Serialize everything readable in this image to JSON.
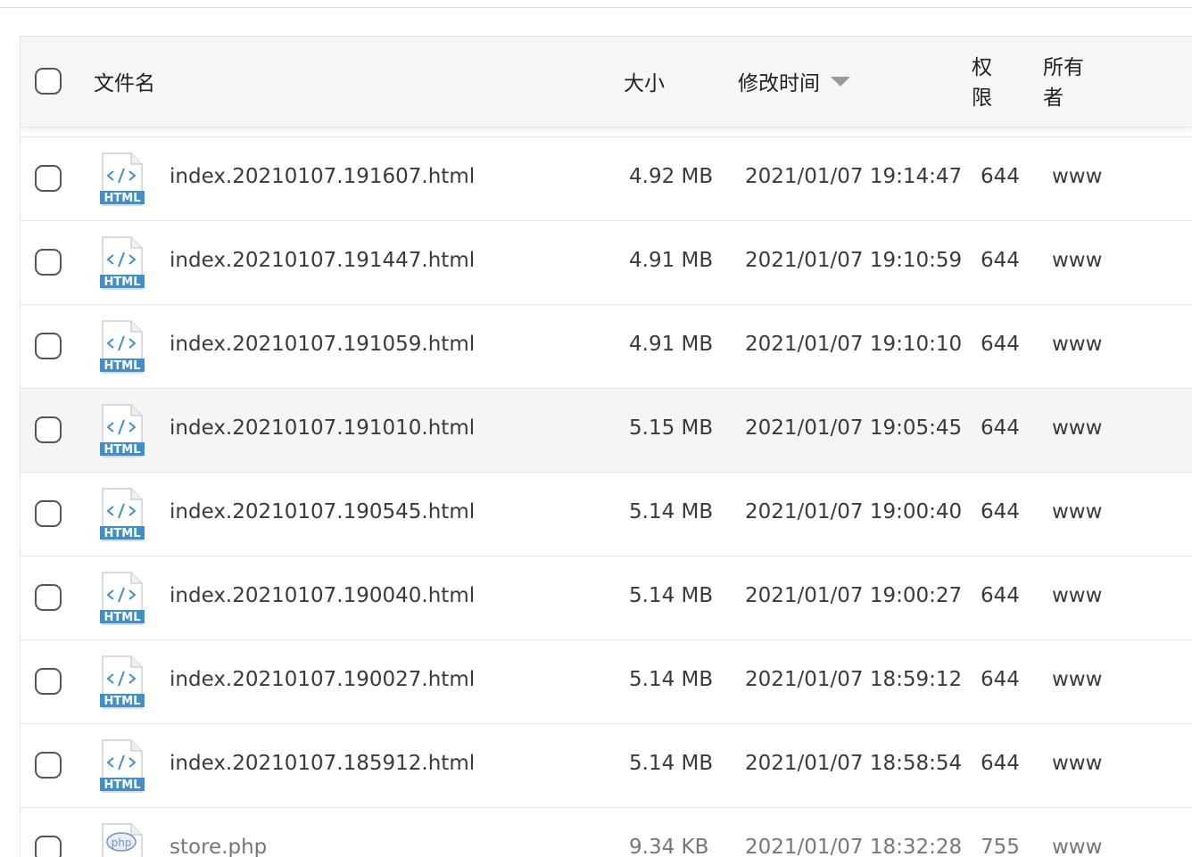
{
  "header": {
    "name": "文件名",
    "size": "大小",
    "mtime": "修改时间",
    "perm_line1": "权",
    "perm_line2": "限",
    "owner_line1": "所有",
    "owner_line2": "者",
    "sort_icon": "sort-desc-icon"
  },
  "files": [
    {
      "name": "index.20210107.191607.html",
      "size": "4.92 MB",
      "mtime": "2021/01/07 19:14:47",
      "perm": "644",
      "owner": "www",
      "icon": "html-file-icon"
    },
    {
      "name": "index.20210107.191447.html",
      "size": "4.91 MB",
      "mtime": "2021/01/07 19:10:59",
      "perm": "644",
      "owner": "www",
      "icon": "html-file-icon"
    },
    {
      "name": "index.20210107.191059.html",
      "size": "4.91 MB",
      "mtime": "2021/01/07 19:10:10",
      "perm": "644",
      "owner": "www",
      "icon": "html-file-icon"
    },
    {
      "name": "index.20210107.191010.html",
      "size": "5.15 MB",
      "mtime": "2021/01/07 19:05:45",
      "perm": "644",
      "owner": "www",
      "icon": "html-file-icon"
    },
    {
      "name": "index.20210107.190545.html",
      "size": "5.14 MB",
      "mtime": "2021/01/07 19:00:40",
      "perm": "644",
      "owner": "www",
      "icon": "html-file-icon"
    },
    {
      "name": "index.20210107.190040.html",
      "size": "5.14 MB",
      "mtime": "2021/01/07 19:00:27",
      "perm": "644",
      "owner": "www",
      "icon": "html-file-icon"
    },
    {
      "name": "index.20210107.190027.html",
      "size": "5.14 MB",
      "mtime": "2021/01/07 18:59:12",
      "perm": "644",
      "owner": "www",
      "icon": "html-file-icon"
    },
    {
      "name": "index.20210107.185912.html",
      "size": "5.14 MB",
      "mtime": "2021/01/07 18:58:54",
      "perm": "644",
      "owner": "www",
      "icon": "html-file-icon"
    },
    {
      "name": "store.php",
      "size": "9.34 KB",
      "mtime": "2021/01/07 18:32:28",
      "perm": "755",
      "owner": "www",
      "icon": "php-file-icon"
    }
  ],
  "icon_labels": {
    "html": "HTML",
    "php": "php"
  },
  "colors": {
    "icon_blue": "#3f8fc8",
    "header_bg": "#f6f6f6",
    "hover_row_bg": "#f5f5f5"
  }
}
